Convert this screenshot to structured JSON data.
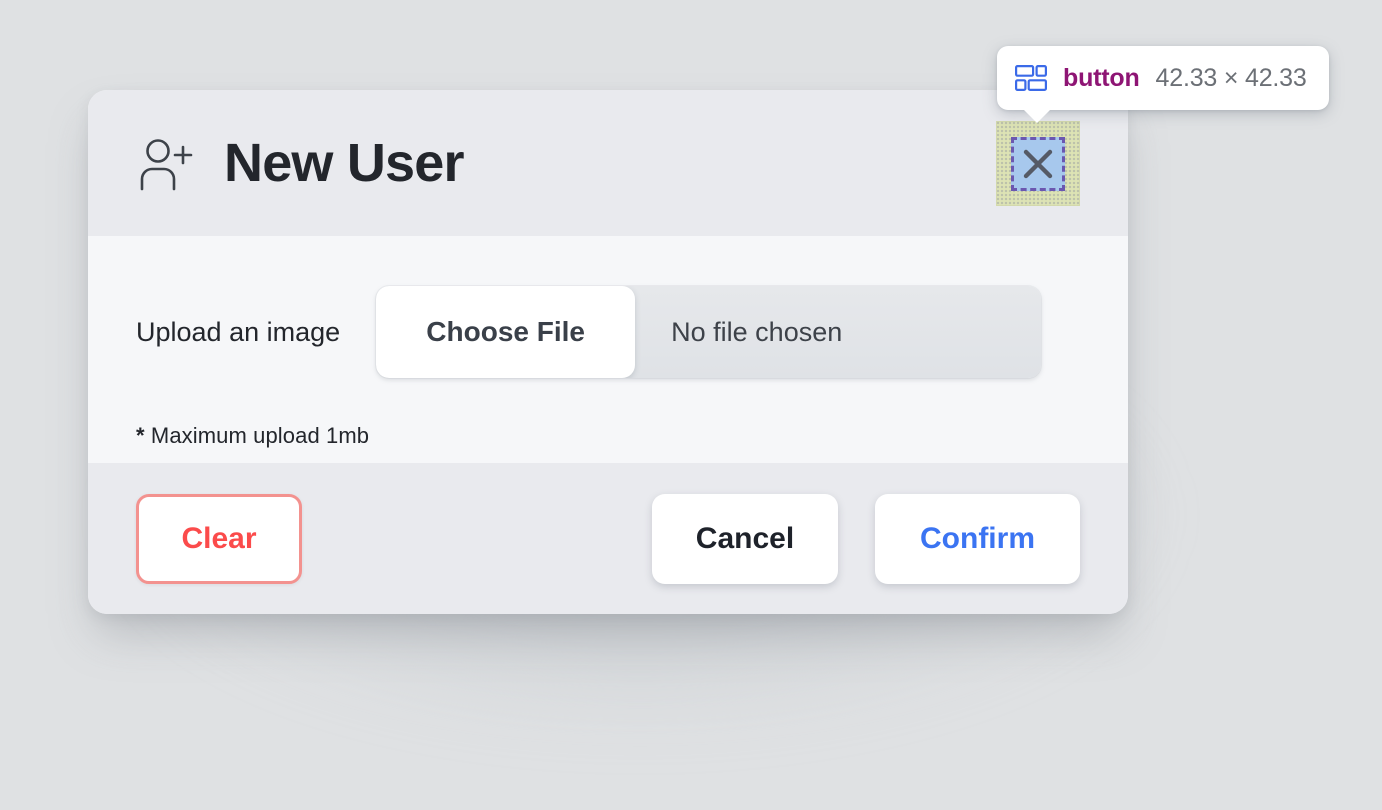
{
  "inspector": {
    "icon": "layout-grid-icon",
    "tag": "button",
    "dimensions": "42.33 × 42.33",
    "tag_color": "#8e1574",
    "dim_color": "#6c7076",
    "highlight_content_color": "#a7c8ed",
    "highlight_padding_color": "#dde3b4",
    "highlight_border_color": "#6b57b0"
  },
  "dialog": {
    "header": {
      "icon": "user-plus-icon",
      "title": "New User",
      "close_button": {
        "icon": "close-x-icon",
        "label": ""
      }
    },
    "body": {
      "upload_label": "Upload an image",
      "file_input": {
        "button_label": "Choose File",
        "file_name": "No file chosen",
        "placeholder": "No file chosen"
      },
      "note_asterisk": "*",
      "note_text": "Maximum upload 1mb"
    },
    "footer": {
      "clear_label": "Clear",
      "cancel_label": "Cancel",
      "confirm_label": "Confirm",
      "clear_color": "#fb4b4b",
      "cancel_color": "#1e222a",
      "confirm_color": "#3b74f2"
    }
  },
  "theme": {
    "page_background": "#dfe1e3",
    "card_background": "#f6f7f9",
    "band_background": "#e9eaee",
    "text_primary": "#23262c"
  }
}
